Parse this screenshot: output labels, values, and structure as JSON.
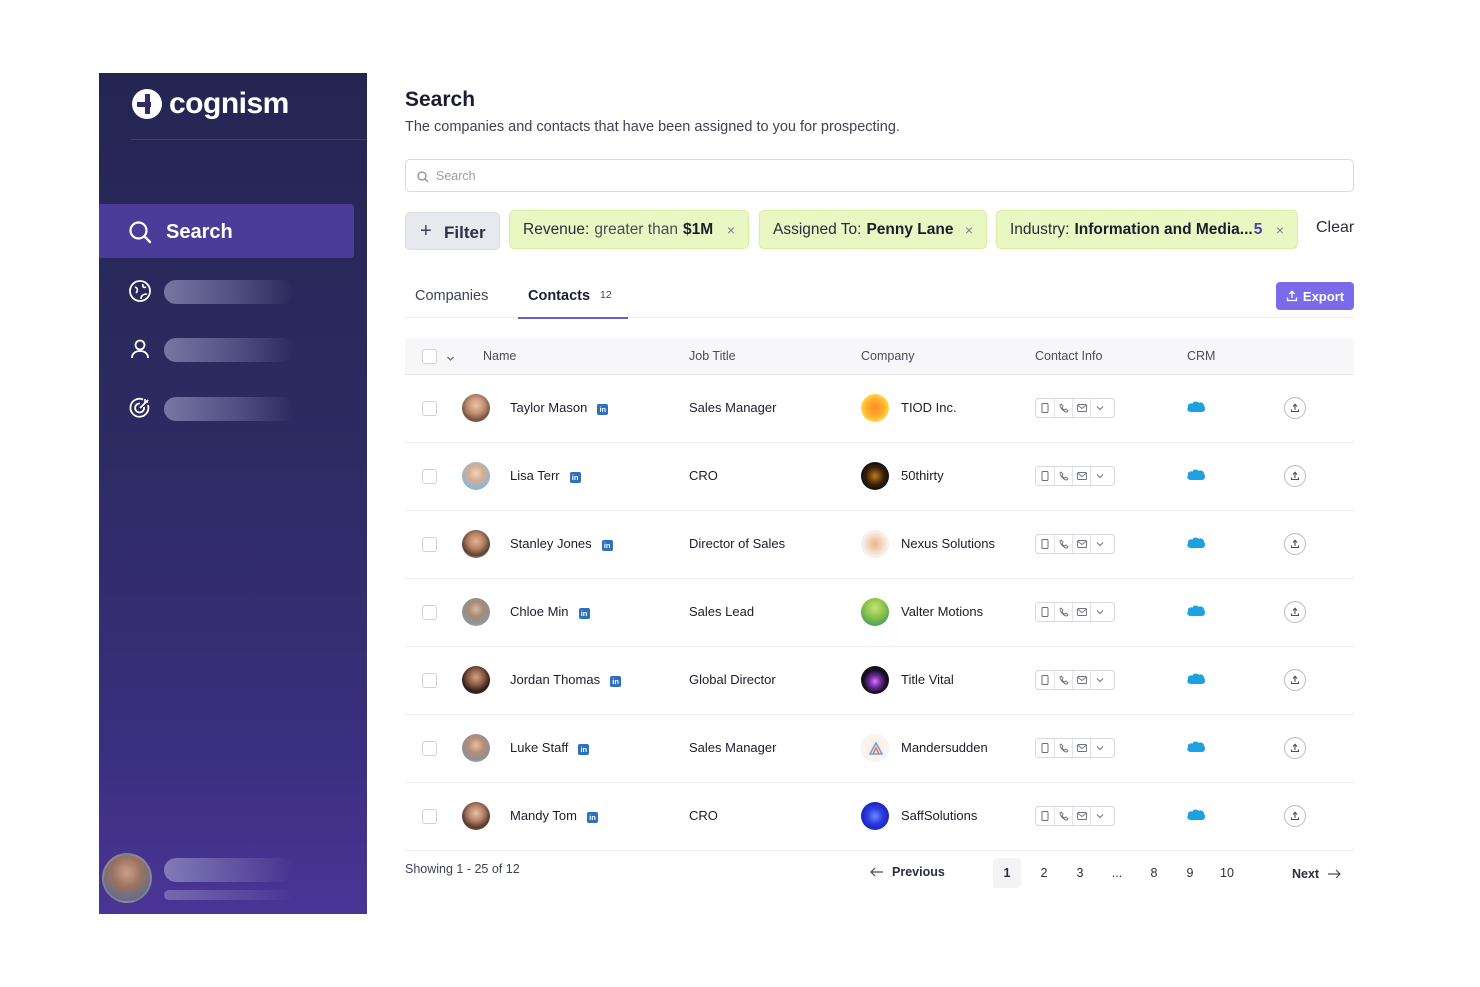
{
  "brand": {
    "name": "cognism"
  },
  "sidebar": {
    "search_label": "Search",
    "items": [
      {
        "icon": "compass-icon"
      },
      {
        "icon": "user-icon"
      },
      {
        "icon": "target-icon"
      }
    ]
  },
  "header": {
    "title": "Search",
    "subtitle": "The companies and contacts that have been assigned to you for prospecting."
  },
  "search": {
    "placeholder": "Search",
    "value": ""
  },
  "filters": {
    "add_label": "Filter",
    "chips": [
      {
        "key": "Revenue:",
        "op": "greater than",
        "value": "$1M",
        "count": ""
      },
      {
        "key": "Assigned To:",
        "op": "",
        "value": "Penny Lane",
        "count": ""
      },
      {
        "key": "Industry:",
        "op": "",
        "value": "Information and Media...",
        "count": "5"
      }
    ],
    "remove_glyph": "×",
    "clear_label": "Clear"
  },
  "tabs": {
    "companies": "Companies",
    "contacts": "Contacts",
    "contacts_count": "12",
    "active": "contacts"
  },
  "export_label": "Export",
  "table": {
    "columns": {
      "name": "Name",
      "job": "Job Title",
      "company": "Company",
      "contact": "Contact Info",
      "crm": "CRM"
    },
    "rows": [
      {
        "name": "Taylor Mason",
        "job": "Sales Manager",
        "company": "TIOD Inc."
      },
      {
        "name": "Lisa Terr",
        "job": "CRO",
        "company": "50thirty"
      },
      {
        "name": "Stanley Jones",
        "job": "Director of Sales",
        "company": "Nexus Solutions"
      },
      {
        "name": "Chloe Min",
        "job": "Sales Lead",
        "company": "Valter Motions"
      },
      {
        "name": "Jordan Thomas",
        "job": "Global Director",
        "company": "Title Vital"
      },
      {
        "name": "Luke Staff",
        "job": "Sales Manager",
        "company": "Mandersudden"
      },
      {
        "name": "Mandy Tom",
        "job": "CRO",
        "company": "SaffSolutions"
      }
    ]
  },
  "pagination": {
    "showing": "Showing 1 - 25 of 12",
    "previous": "Previous",
    "next": "Next",
    "pages": [
      "1",
      "2",
      "3",
      "...",
      "8",
      "9",
      "10"
    ],
    "current": "1"
  },
  "colors": {
    "sidebar_top": "#252552",
    "sidebar_bottom": "#4a3596",
    "accent": "#7a6bea",
    "chip_bg": "#e9f7c2",
    "salesforce": "#1ea1e1",
    "linkedin": "#2f6fbf"
  }
}
